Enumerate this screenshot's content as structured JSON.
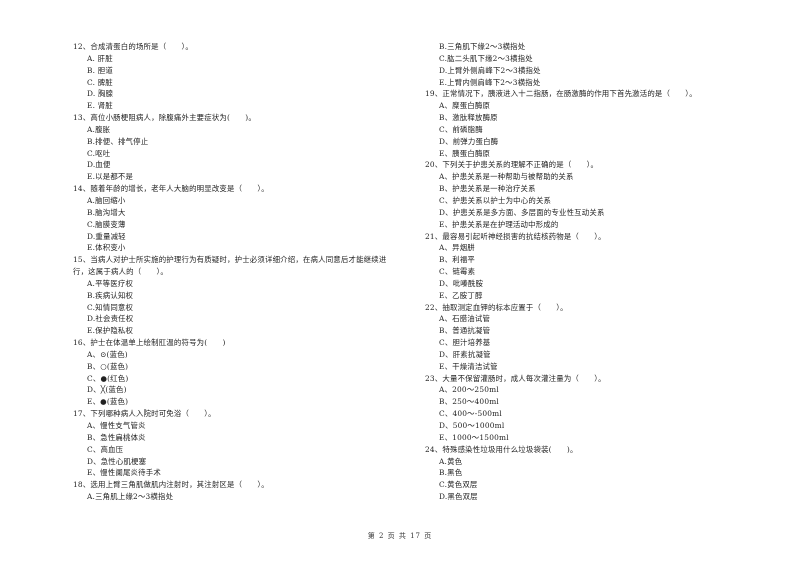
{
  "left_column": [
    {
      "type": "q",
      "text": "12、合成清蛋白的场所是（　　）。"
    },
    {
      "type": "opt",
      "text": "A. 肝脏"
    },
    {
      "type": "opt",
      "text": "B. 胆道"
    },
    {
      "type": "opt",
      "text": "C. 脾脏"
    },
    {
      "type": "opt",
      "text": "D. 胸腺"
    },
    {
      "type": "opt",
      "text": "E. 肾脏"
    },
    {
      "type": "q",
      "text": "13、高位小肠梗阻病人，除腹痛外主要症状为(　　)。"
    },
    {
      "type": "opt",
      "text": "A.腹胀"
    },
    {
      "type": "opt",
      "text": "B.排便、排气停止"
    },
    {
      "type": "opt",
      "text": "C.呕吐"
    },
    {
      "type": "opt",
      "text": "D.血便"
    },
    {
      "type": "opt",
      "text": "E.以是都不是"
    },
    {
      "type": "q",
      "text": "14、随着年龄的增长，老年人大脑的明显改变是（　　）。"
    },
    {
      "type": "opt",
      "text": "A.脑回缩小"
    },
    {
      "type": "opt",
      "text": "B.脑沟增大"
    },
    {
      "type": "opt",
      "text": "C.脑膜变薄"
    },
    {
      "type": "opt",
      "text": "D.重量减轻"
    },
    {
      "type": "opt",
      "text": "E.体积变小"
    },
    {
      "type": "q",
      "text": "15、当病人对护士所实施的护理行为有质疑时，护士必须详细介绍，在病人同意后才能继续进"
    },
    {
      "type": "q",
      "text": "行，这属于病人的（　　）。"
    },
    {
      "type": "opt",
      "text": "A.平等医疗权"
    },
    {
      "type": "opt",
      "text": "B.疾病认知权"
    },
    {
      "type": "opt",
      "text": "C.知情同意权"
    },
    {
      "type": "opt",
      "text": "D.社会责任权"
    },
    {
      "type": "opt",
      "text": "E.保护隐私权"
    },
    {
      "type": "q",
      "text": "16、护士在体温单上绘制肛温的符号为(　　)"
    },
    {
      "type": "opt",
      "text": "A、⊙(蓝色)"
    },
    {
      "type": "opt",
      "text": "B、○(蓝色)"
    },
    {
      "type": "opt",
      "text": "C、●(红色)"
    },
    {
      "type": "opt",
      "text": "D、╳(蓝色)"
    },
    {
      "type": "opt",
      "text": "E、●(蓝色)"
    },
    {
      "type": "q",
      "text": "17、下列哪种病人入院时可免浴（　　）。"
    },
    {
      "type": "opt",
      "text": "A、慢性支气管炎"
    },
    {
      "type": "opt",
      "text": "B、急性扁桃体炎"
    },
    {
      "type": "opt",
      "text": "C、高血压"
    },
    {
      "type": "opt",
      "text": "D、急性心肌梗塞"
    },
    {
      "type": "opt",
      "text": "E、慢性阑尾炎待手术"
    },
    {
      "type": "q",
      "text": "18、选用上臂三角肌做肌内注射时，其注射区是（　　）。"
    },
    {
      "type": "opt",
      "text": "A.三角肌上缘2～3横指处"
    }
  ],
  "right_column": [
    {
      "type": "opt",
      "text": "B.三角肌下缘2～3横指处"
    },
    {
      "type": "opt",
      "text": "C.肱二头肌下缘2～3横指处"
    },
    {
      "type": "opt",
      "text": "D.上臂外侧肩峰下2～3横指处"
    },
    {
      "type": "opt",
      "text": "E.上臂内侧肩峰下2～3横指处"
    },
    {
      "type": "q",
      "text": "19、正常情况下，胰液进入十二指肠，在肠激酶的作用下首先激活的是（　　）。"
    },
    {
      "type": "opt",
      "text": "A、糜蛋白酶原"
    },
    {
      "type": "opt",
      "text": "B、激肽释放酶原"
    },
    {
      "type": "opt",
      "text": "C、前磷脂酶"
    },
    {
      "type": "opt",
      "text": "D、前弹力蛋白酶"
    },
    {
      "type": "opt",
      "text": "E、胰蛋白酶原"
    },
    {
      "type": "q",
      "text": "20、下列关于护患关系的理解不正确的是（　　）。"
    },
    {
      "type": "opt",
      "text": "A、护患关系是一种帮助与被帮助的关系"
    },
    {
      "type": "opt",
      "text": "B、护患关系是一种治疗关系"
    },
    {
      "type": "opt",
      "text": "C、护患关系以护士为中心的关系"
    },
    {
      "type": "opt",
      "text": "D、护患关系是多方面、多层面的专业性互动关系"
    },
    {
      "type": "opt",
      "text": "E、护患关系是在护理活动中形成的"
    },
    {
      "type": "q",
      "text": "21、最容易引起听神经损害的抗结核药物是（　　）。"
    },
    {
      "type": "opt",
      "text": "A、异烟肼"
    },
    {
      "type": "opt",
      "text": "B、利福平"
    },
    {
      "type": "opt",
      "text": "C、链霉素"
    },
    {
      "type": "opt",
      "text": "D、吡嗪酰胺"
    },
    {
      "type": "opt",
      "text": "E、乙胺丁醇"
    },
    {
      "type": "q",
      "text": "22、抽取测定血钾的标本应置于（　　）。"
    },
    {
      "type": "opt",
      "text": "A、石腊油试管"
    },
    {
      "type": "opt",
      "text": "B、普通抗凝管"
    },
    {
      "type": "opt",
      "text": "C、胆汁培养基"
    },
    {
      "type": "opt",
      "text": "D、肝素抗凝管"
    },
    {
      "type": "opt",
      "text": "E、干燥清洁试管"
    },
    {
      "type": "q",
      "text": "23、大量不保留灌肠时，成人每次灌注量为（　　）。"
    },
    {
      "type": "opt",
      "text": "A、200～250ml"
    },
    {
      "type": "opt",
      "text": "B、250～400ml"
    },
    {
      "type": "opt",
      "text": "C、400～-500ml"
    },
    {
      "type": "opt",
      "text": "D、500～1000ml"
    },
    {
      "type": "opt",
      "text": "E、1000～1500ml"
    },
    {
      "type": "q",
      "text": "24、特殊感染性垃圾用什么垃圾袋装(　　)。"
    },
    {
      "type": "opt",
      "text": "A.黄色"
    },
    {
      "type": "opt",
      "text": "B.黑色"
    },
    {
      "type": "opt",
      "text": "C.黄色双层"
    },
    {
      "type": "opt",
      "text": "D.黑色双层"
    }
  ],
  "footer": {
    "page_label": "第 2 页 共 17 页"
  }
}
